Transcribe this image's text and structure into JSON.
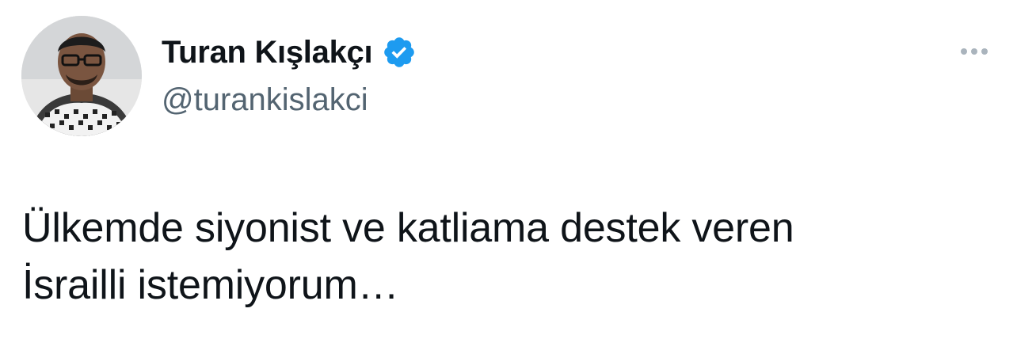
{
  "author": {
    "display_name": "Turan Kışlakçı",
    "handle": "@turankislakci",
    "verified": true,
    "verified_color": "#1d9bf0"
  },
  "tweet": {
    "text_lines": [
      "Ülkemde siyonist ve katliama destek veren",
      "İsrailli istemiyorum…"
    ]
  },
  "icons": {
    "avatar": "profile-photo",
    "verified": "verified-badge-icon",
    "more": "more-options-icon"
  },
  "colors": {
    "text_primary": "#0f1419",
    "text_secondary": "#536471",
    "more_dots": "#aab4bd"
  }
}
